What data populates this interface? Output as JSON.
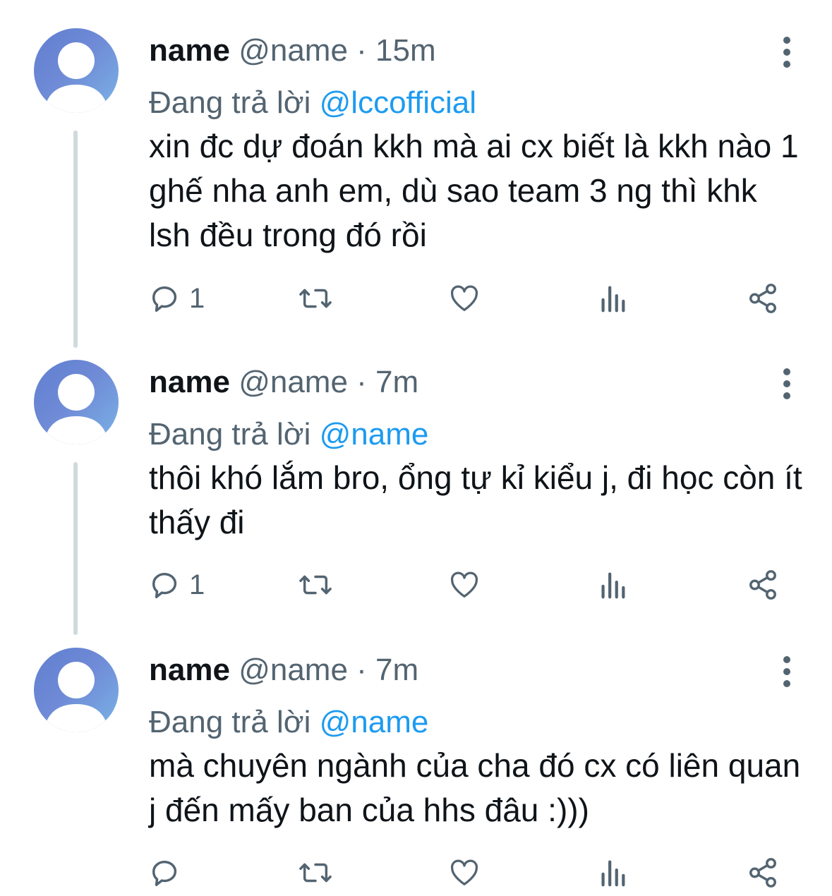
{
  "colors": {
    "link": "#1d9bf0",
    "secondary": "#536471",
    "primary": "#0f1419",
    "thread": "#cfd9de"
  },
  "icons": [
    "more-vertical-icon",
    "reply-icon",
    "retweet-icon",
    "like-icon",
    "views-icon",
    "share-icon",
    "default-avatar-icon"
  ],
  "tweets": [
    {
      "name": "name",
      "handle": "@name",
      "separator": "·",
      "time": "15m",
      "reply_prefix": "Đang trả lời",
      "reply_to": "@lccofficial",
      "text": "xin đc dự đoán kkh mà ai cx biết là kkh nào 1 ghế nha anh em, dù sao team 3 ng thì khk lsh đều trong đó rồi",
      "reply_count": "1"
    },
    {
      "name": "name",
      "handle": "@name",
      "separator": "·",
      "time": "7m",
      "reply_prefix": "Đang trả lời",
      "reply_to": "@name",
      "text": "thôi khó lắm bro, ổng tự kỉ kiểu j, đi học còn ít thấy đi",
      "reply_count": "1"
    },
    {
      "name": "name",
      "handle": "@name",
      "separator": "·",
      "time": "7m",
      "reply_prefix": "Đang trả lời",
      "reply_to": "@name",
      "text": "mà chuyên ngành của cha đó cx có liên quan j đến mấy ban của hhs đâu :)))",
      "reply_count": ""
    }
  ]
}
